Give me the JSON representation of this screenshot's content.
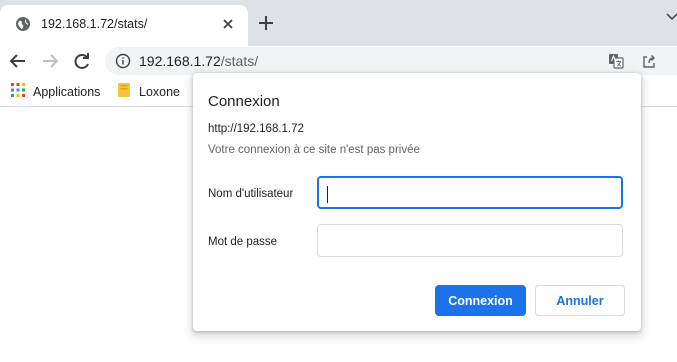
{
  "browser": {
    "tab": {
      "title": "192.168.1.72/stats/"
    },
    "address": {
      "host": "192.168.1.72",
      "path": "/stats/"
    },
    "bookmarks": [
      {
        "label": "Applications",
        "icon": "apps-grid-icon"
      },
      {
        "label": "Loxone",
        "icon": "folder-icon"
      }
    ]
  },
  "dialog": {
    "title": "Connexion",
    "url": "http://192.168.1.72",
    "warning": "Votre connexion à ce site n'est pas privée",
    "username_label": "Nom d'utilisateur",
    "username_value": "",
    "password_label": "Mot de passe",
    "password_value": "",
    "submit_label": "Connexion",
    "cancel_label": "Annuler"
  },
  "colors": {
    "accent": "#1a73e8",
    "tabstrip": "#dee1e6",
    "omnibox": "#f1f3f4"
  }
}
